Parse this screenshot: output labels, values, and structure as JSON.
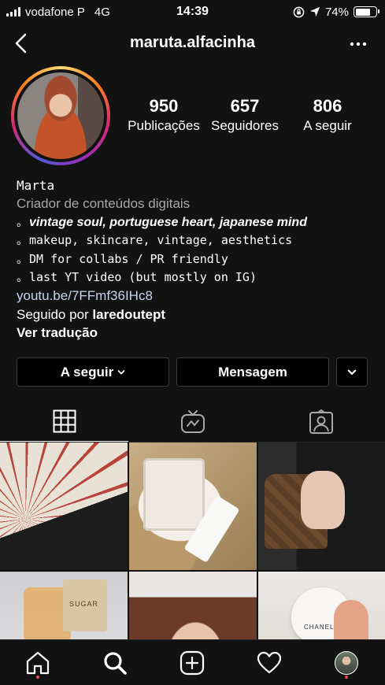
{
  "status_bar": {
    "carrier": "vodafone P",
    "network": "4G",
    "time": "14:39",
    "battery": "74%",
    "battery_level": 0.74
  },
  "header": {
    "username": "maruta.alfacinha",
    "back_icon": "chevron-left-icon",
    "more_icon": "ellipsis-icon"
  },
  "profile": {
    "stats": [
      {
        "value": "950",
        "label": "Publicações"
      },
      {
        "value": "657",
        "label": "Seguidores"
      },
      {
        "value": "806",
        "label": "A seguir"
      }
    ],
    "name": "Marta",
    "category": "Criador de conteúdos digitais",
    "bio_lines": [
      {
        "bullet": "。",
        "text": "vintage soul, portuguese heart, japanese mind"
      },
      {
        "bullet": "。",
        "text": "makeup, skincare, vintage, aesthetics"
      },
      {
        "bullet": "。",
        "text": "DM for collabs / PR friendly"
      },
      {
        "bullet": "。",
        "text": "last YT video (but mostly on IG)"
      }
    ],
    "link": "youtu.be/7FFmf36IHc8",
    "followed_by_prefix": "Seguido por",
    "followed_by_user": "laredoutept",
    "translate": "Ver tradução"
  },
  "actions": {
    "following": "A seguir",
    "message": "Mensagem"
  },
  "tabs": [
    {
      "name": "grid",
      "icon": "grid-icon"
    },
    {
      "name": "igtv",
      "icon": "igtv-icon"
    },
    {
      "name": "tagged",
      "icon": "tagged-icon"
    }
  ],
  "grid_posts": [
    {
      "subject": "paper fan"
    },
    {
      "subject": "jewelry box"
    },
    {
      "subject": "handbag"
    },
    {
      "subject": "perfume and book",
      "text": "SUGAR"
    },
    {
      "subject": "portrait"
    },
    {
      "subject": "hand cream",
      "text": "CHANEL"
    }
  ],
  "bottom_nav": [
    {
      "name": "home",
      "icon": "home-icon"
    },
    {
      "name": "search",
      "icon": "search-icon"
    },
    {
      "name": "new-post",
      "icon": "plus-square-icon"
    },
    {
      "name": "activity",
      "icon": "heart-icon"
    },
    {
      "name": "profile",
      "icon": "avatar"
    }
  ],
  "colors": {
    "background": "#121212",
    "link": "#c7d5ec",
    "notification_dot": "#ed4956",
    "muted_text": "#a8a8a8"
  }
}
